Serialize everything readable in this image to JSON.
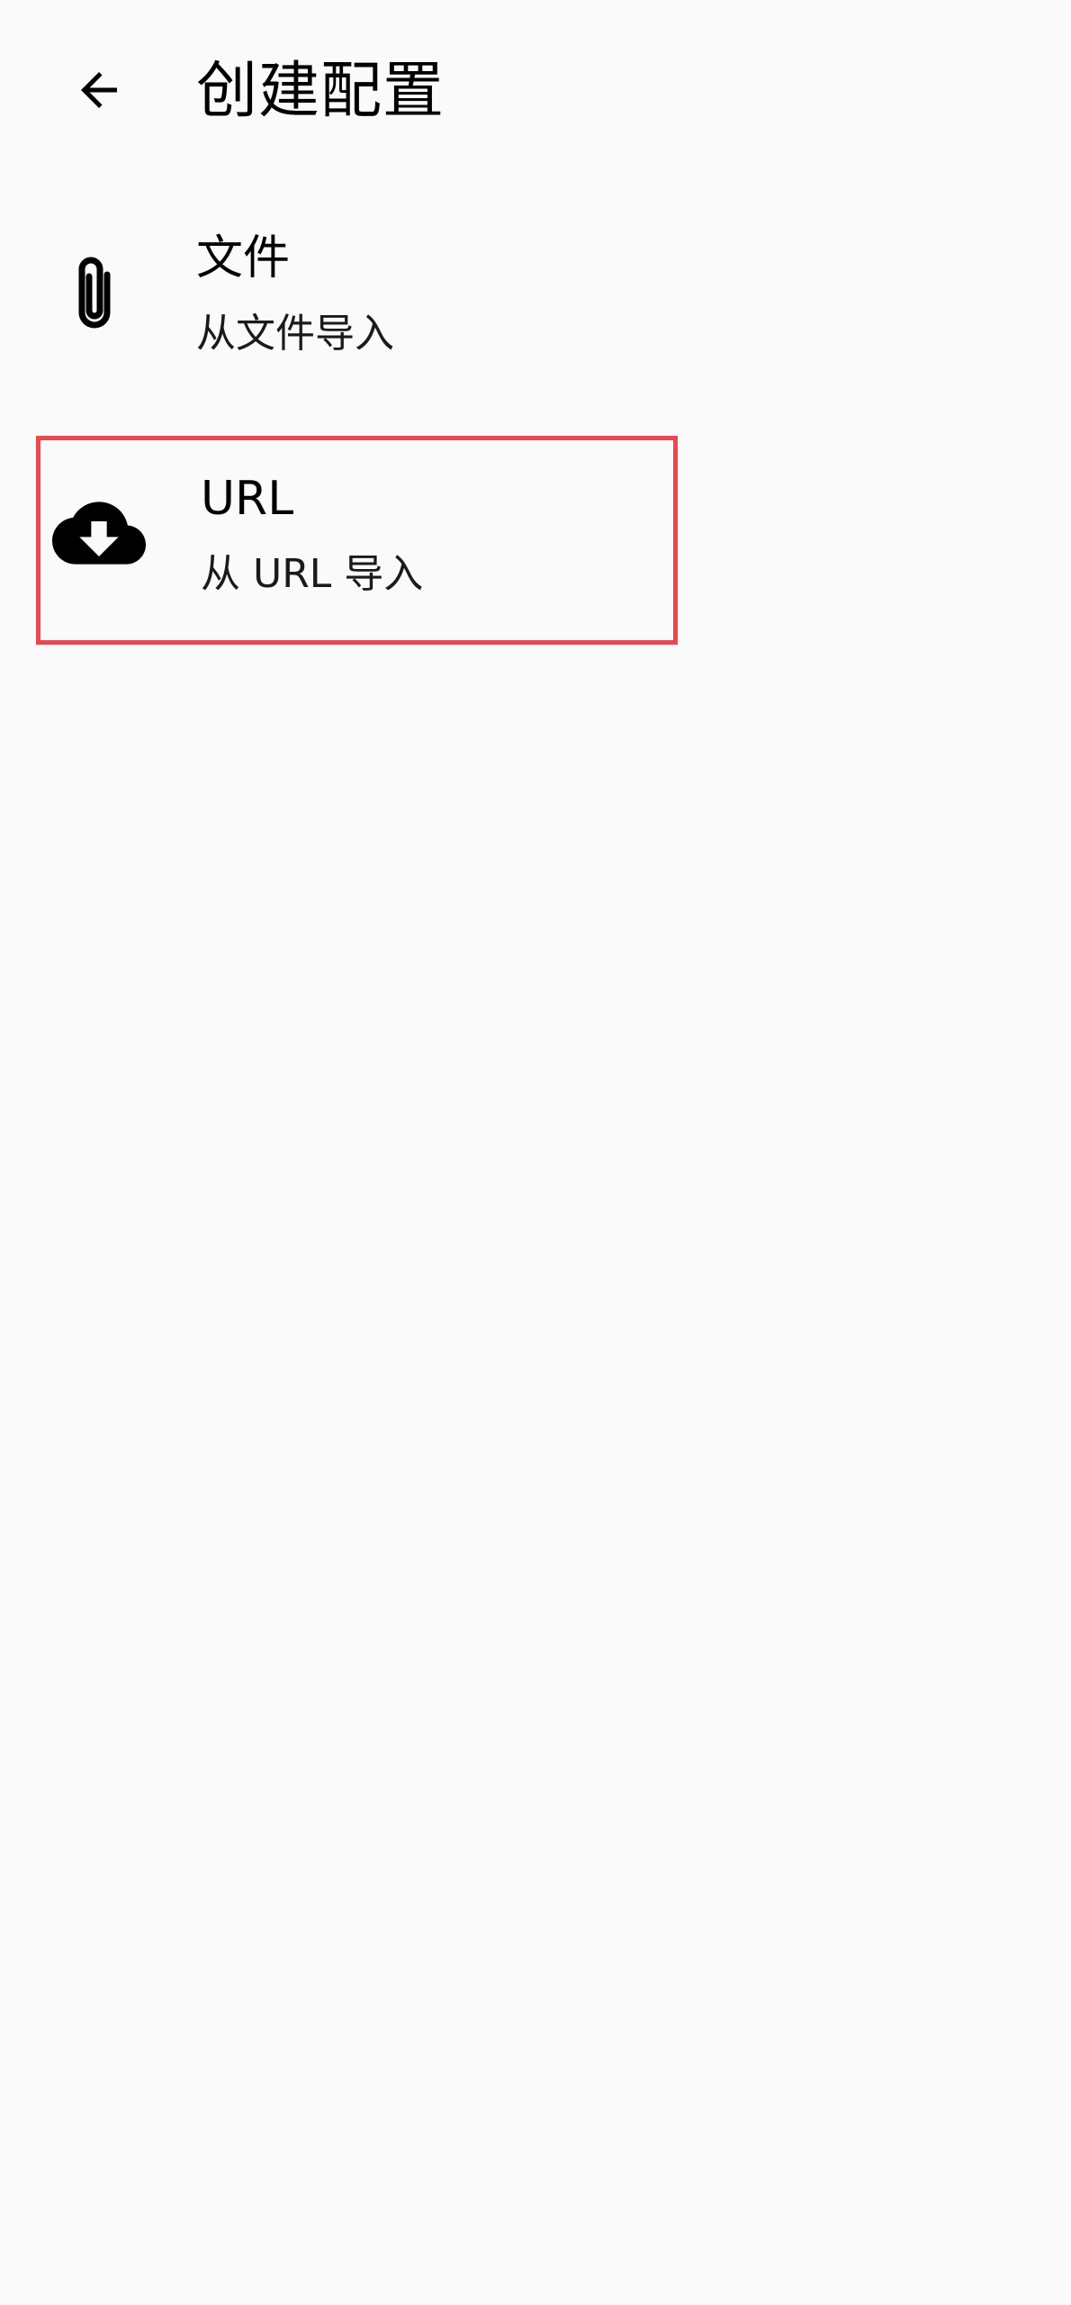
{
  "app_bar": {
    "title": "创建配置",
    "back_icon": "arrow-back-icon"
  },
  "options": [
    {
      "title": "文件",
      "subtitle": "从文件导入",
      "icon": "paperclip-icon"
    },
    {
      "title": "URL",
      "subtitle": "从 URL 导入",
      "icon": "cloud-download-icon"
    }
  ],
  "colors": {
    "background": "#fafafa",
    "text": "#000000",
    "highlight_border": "#e8484f"
  }
}
